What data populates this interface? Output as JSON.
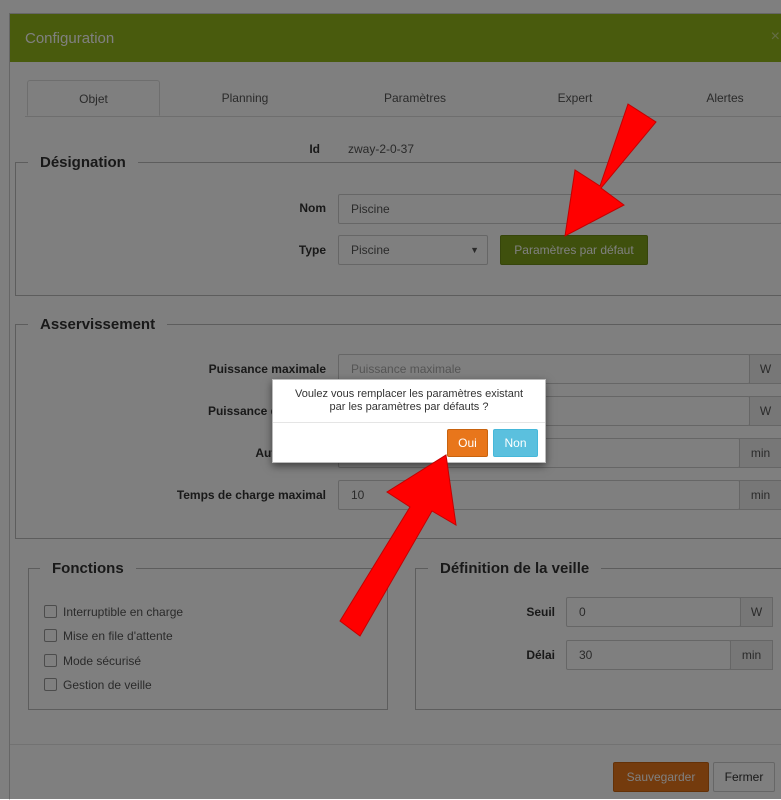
{
  "modal": {
    "title": "Configuration",
    "close": "×"
  },
  "tabs": [
    "Objet",
    "Planning",
    "Paramètres",
    "Expert",
    "Alertes"
  ],
  "id_row": {
    "label": "Id",
    "value": "zway-2-0-37"
  },
  "designation": {
    "legend": "Désignation",
    "nom_label": "Nom",
    "nom_value": "Piscine",
    "type_label": "Type",
    "type_value": "Piscine",
    "default_button": "Paramètres par défaut"
  },
  "asservissement": {
    "legend": "Asservissement",
    "puissance_max_label": "Puissance maximale",
    "puissance_max_placeholder": "Puissance maximale",
    "puissance_max_unit": "W",
    "puissance_decl_label": "Puissance de déclen",
    "puissance_decl_unit": "W",
    "autonomie_label": "Autonomie r",
    "autonomie_unit": "min",
    "temps_charge_label": "Temps de charge maximal",
    "temps_charge_value": "10",
    "temps_charge_unit": "min"
  },
  "fonctions": {
    "legend": "Fonctions",
    "items": [
      "Interruptible en charge",
      "Mise en file d'attente",
      "Mode sécurisé",
      "Gestion de veille"
    ]
  },
  "veille": {
    "legend": "Définition de la veille",
    "seuil_label": "Seuil",
    "seuil_value": "0",
    "seuil_unit": "W",
    "delai_label": "Délai",
    "delai_value": "30",
    "delai_unit": "min"
  },
  "footer": {
    "save": "Sauvegarder",
    "close": "Fermer"
  },
  "dialog": {
    "line1": "Voulez vous remplacer les paramètres existant",
    "line2": "par les paramètres par défauts ?",
    "yes": "Oui",
    "no": "Non"
  },
  "colors": {
    "header": "#93b71a",
    "primary_button": "#7ea11a",
    "save_button": "#e8761b",
    "yes_button": "#e8761b",
    "no_button": "#5bc0de",
    "arrow": "#ff0000"
  }
}
